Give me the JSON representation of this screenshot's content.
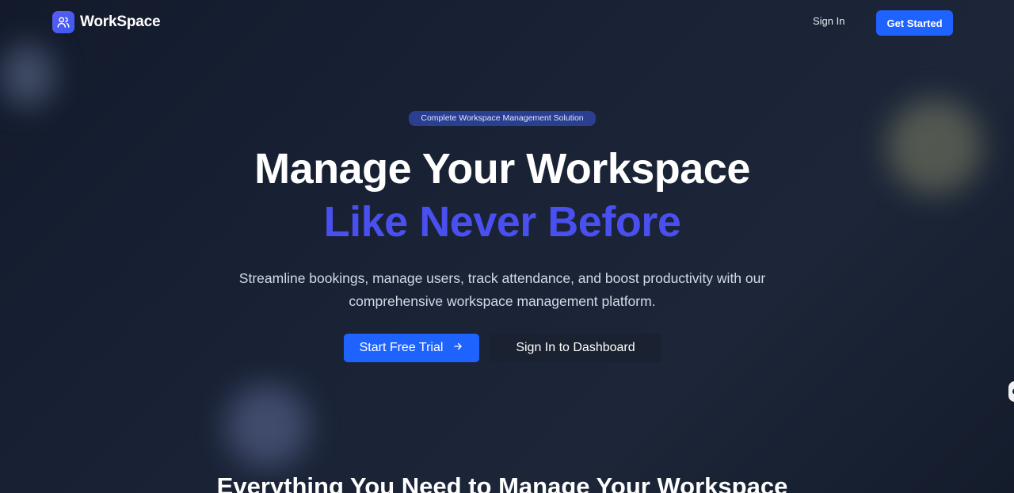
{
  "nav": {
    "brand": "WorkSpace",
    "logo_icon": "users-icon",
    "sign_in": "Sign In",
    "get_started": "Get Started"
  },
  "hero": {
    "badge": "Complete Workspace Management Solution",
    "title_line1": "Manage Your Workspace",
    "title_line2": "Like Never Before",
    "subtitle": "Streamline bookings, manage users, track attendance, and boost productivity with our comprehensive workspace management platform.",
    "primary_cta": "Start Free Trial",
    "primary_cta_icon": "arrow-right-icon",
    "secondary_cta": "Sign In to Dashboard"
  },
  "features": {
    "title": "Everything You Need to Manage Your Workspace"
  },
  "colors": {
    "accent": "#1f63ff",
    "highlight": "#4a4ff0",
    "background": "#1a2336"
  }
}
